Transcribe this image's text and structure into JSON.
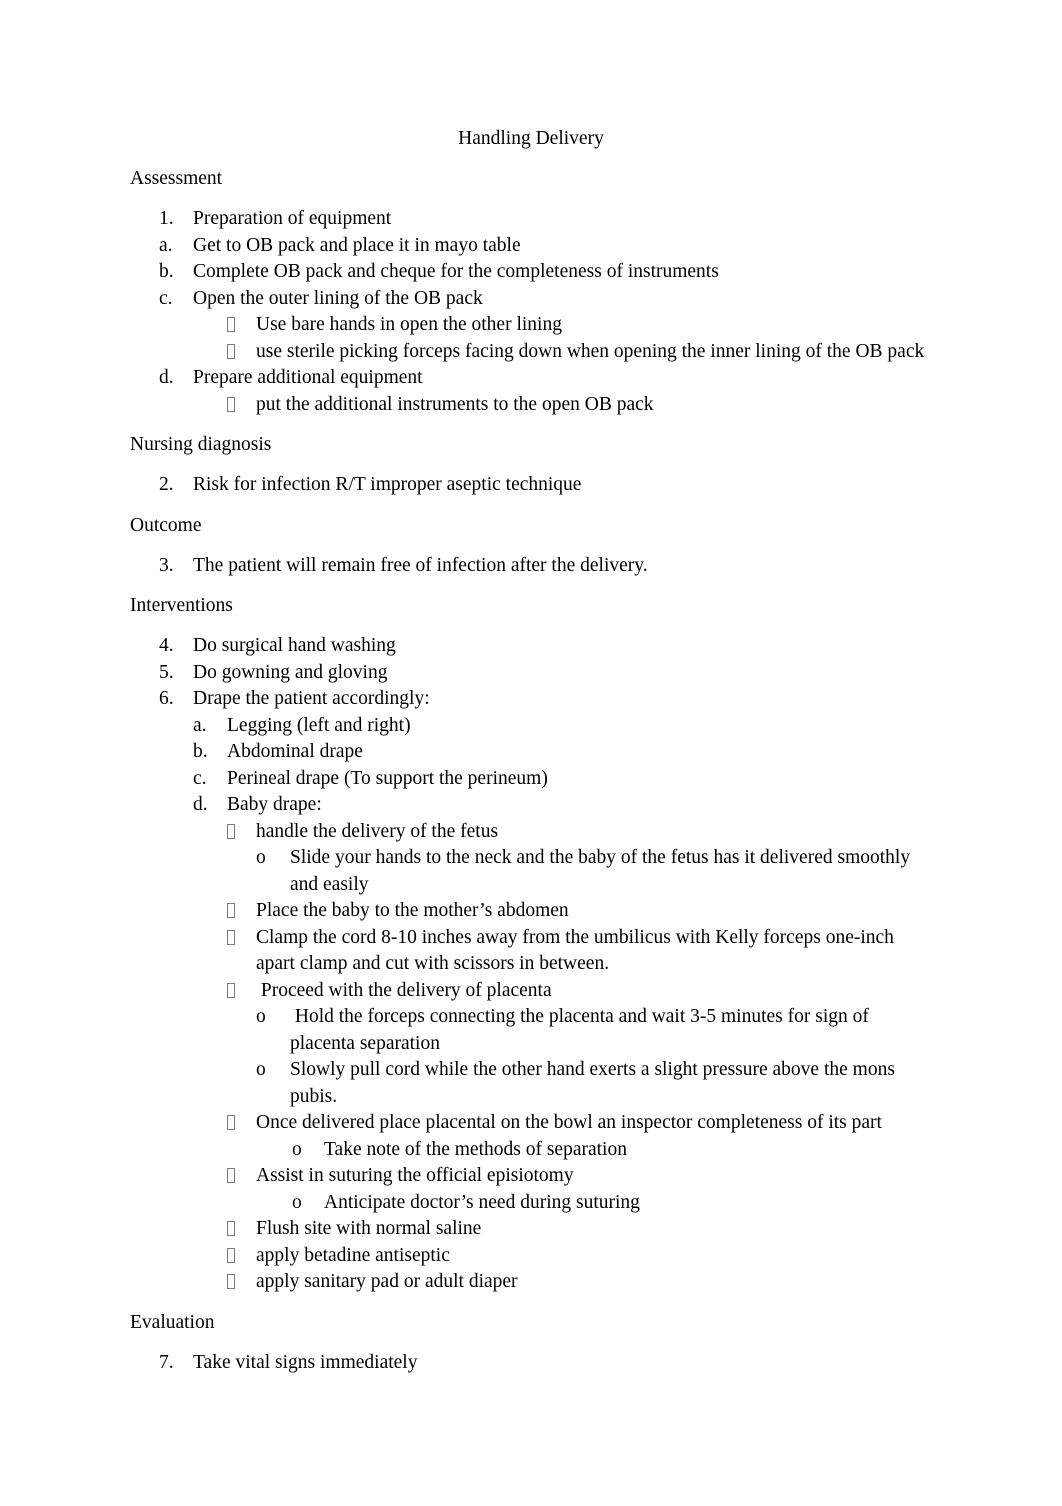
{
  "document": {
    "title": "Handling Delivery",
    "bullet_glyph_name": "missing-glyph-box",
    "text_color": "#000000",
    "background_color": "#ffffff"
  },
  "sections": [
    {
      "heading": "Assessment",
      "items": [
        {
          "level": 1,
          "marker": "1.",
          "text": "Preparation of equipment"
        },
        {
          "level": 1,
          "marker": "a.",
          "text": "Get to OB pack and place it in mayo table"
        },
        {
          "level": 1,
          "marker": "b.",
          "text": "Complete OB pack and cheque for the completeness of instruments"
        },
        {
          "level": 1,
          "marker": "c.",
          "text": "Open the outer lining of the OB pack"
        },
        {
          "level": 2,
          "marker": "box",
          "text": "Use bare hands in open the other lining"
        },
        {
          "level": 2,
          "marker": "box",
          "text": "use sterile picking forceps facing down when opening the inner lining of the OB pack"
        },
        {
          "level": 1,
          "marker": "d.",
          "text": "Prepare additional equipment"
        },
        {
          "level": 2,
          "marker": "box",
          "text": "put the additional instruments to the open OB pack"
        }
      ]
    },
    {
      "heading": "Nursing diagnosis",
      "items": [
        {
          "level": 1,
          "marker": "2.",
          "text": "Risk for infection R/T improper aseptic technique"
        }
      ]
    },
    {
      "heading": "Outcome",
      "items": [
        {
          "level": 1,
          "marker": "3.",
          "text": "The patient will remain free of infection after the delivery."
        }
      ]
    },
    {
      "heading": "Interventions",
      "items": [
        {
          "level": 1,
          "marker": "4.",
          "text": "Do surgical hand washing"
        },
        {
          "level": 1,
          "marker": "5.",
          "text": "Do gowning and gloving"
        },
        {
          "level": 1,
          "marker": "6.",
          "text": "Drape the patient accordingly:"
        },
        {
          "level": "2b",
          "marker": "a.",
          "text": "Legging (left and right)"
        },
        {
          "level": "2b",
          "marker": "b.",
          "text": "Abdominal drape"
        },
        {
          "level": "2b",
          "marker": "c.",
          "text": "Perineal drape (To support the perineum)"
        },
        {
          "level": "2b",
          "marker": "d.",
          "text": "Baby drape:"
        },
        {
          "level": 2,
          "marker": "box",
          "text": "handle the delivery of the fetus"
        },
        {
          "level": 3,
          "marker": "o",
          "text": "Slide your hands to the neck and the baby of the fetus has it delivered smoothly and easily"
        },
        {
          "level": 2,
          "marker": "box",
          "text": "Place the baby to the mother’s abdomen"
        },
        {
          "level": 2,
          "marker": "box",
          "text": "Clamp the cord 8-10 inches away from the umbilicus with Kelly forceps one-inch apart clamp and cut with scissors in between."
        },
        {
          "level": 2,
          "marker": "box",
          "text": " Proceed with the delivery of placenta"
        },
        {
          "level": 3,
          "marker": "o",
          "text": " Hold the forceps connecting the placenta and wait 3-5 minutes for sign of placenta separation"
        },
        {
          "level": 3,
          "marker": "o",
          "text": "Slowly pull cord while the other hand exerts a slight pressure above the mons pubis."
        },
        {
          "level": 2,
          "marker": "box",
          "text": "Once delivered place placental on the bowl an inspector completeness of its part"
        },
        {
          "level": 4,
          "marker": "o",
          "text": "Take note of the methods of separation"
        },
        {
          "level": 2,
          "marker": "box",
          "text": "Assist in suturing the official episiotomy"
        },
        {
          "level": 4,
          "marker": "o",
          "text": "Anticipate doctor’s need during suturing"
        },
        {
          "level": 2,
          "marker": "box",
          "text": "Flush site with normal saline"
        },
        {
          "level": 2,
          "marker": "box",
          "text": "apply betadine antiseptic"
        },
        {
          "level": 2,
          "marker": "box",
          "text": "apply sanitary pad or adult diaper"
        }
      ]
    },
    {
      "heading": "Evaluation",
      "items": [
        {
          "level": 1,
          "marker": "7.",
          "text": "Take vital signs immediately"
        }
      ]
    }
  ]
}
